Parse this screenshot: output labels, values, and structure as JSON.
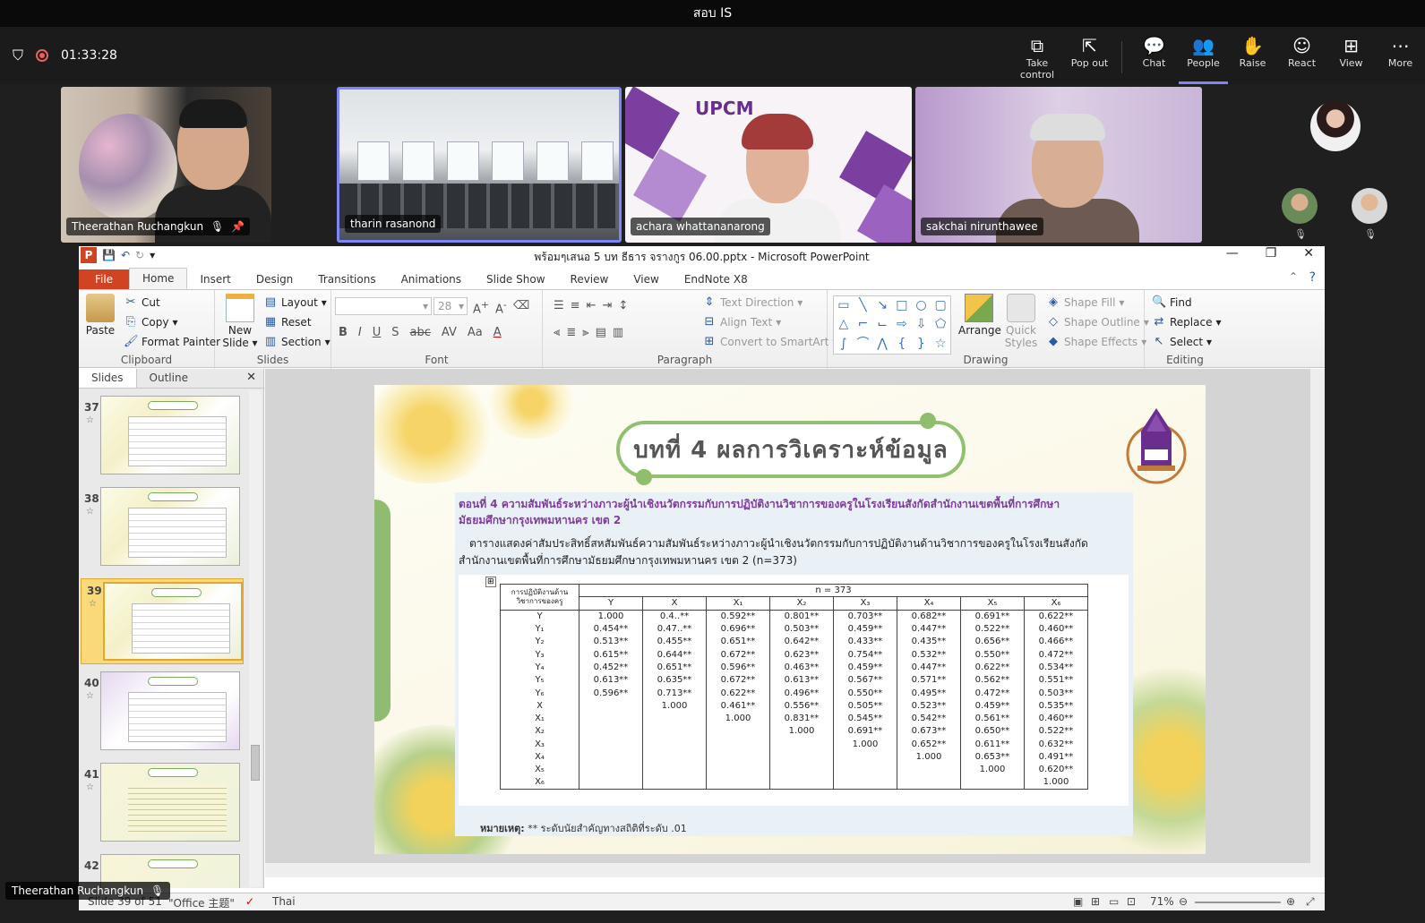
{
  "meeting": {
    "title": "สอบ IS",
    "recording_time": "01:33:28",
    "actions": [
      {
        "label": "Take control",
        "icon": "take-control-icon"
      },
      {
        "label": "Pop out",
        "icon": "pop-out-icon"
      },
      {
        "label": "Chat",
        "icon": "chat-icon"
      },
      {
        "label": "People",
        "icon": "people-icon"
      },
      {
        "label": "Raise",
        "icon": "raise-hand-icon"
      },
      {
        "label": "React",
        "icon": "react-icon"
      },
      {
        "label": "View",
        "icon": "view-icon"
      },
      {
        "label": "More",
        "icon": "more-icon"
      }
    ],
    "participants": [
      {
        "name": "Theerathan Ruchangkun"
      },
      {
        "name": "tharin rasanond"
      },
      {
        "name": "achara whattananarong"
      },
      {
        "name": "sakchai nirunthawee"
      }
    ],
    "presenter_name": "Theerathan Ruchangkun"
  },
  "ppt": {
    "window_title": "พร้อมๆเสนอ 5 บท ธีธาร จรางกูร 06.00.pptx  -  Microsoft PowerPoint",
    "tabs": [
      "File",
      "Home",
      "Insert",
      "Design",
      "Transitions",
      "Animations",
      "Slide Show",
      "Review",
      "View",
      "EndNote X8"
    ],
    "ribbon": {
      "clipboard": {
        "label": "Clipboard",
        "paste": "Paste",
        "cut": "Cut",
        "copy": "Copy",
        "format_painter": "Format Painter"
      },
      "slides": {
        "label": "Slides",
        "new_slide": "New Slide",
        "layout": "Layout",
        "reset": "Reset",
        "section": "Section"
      },
      "font": {
        "label": "Font",
        "size": "28"
      },
      "paragraph": {
        "label": "Paragraph",
        "text_direction": "Text Direction",
        "align_text": "Align Text",
        "convert_smartart": "Convert to SmartArt"
      },
      "drawing": {
        "label": "Drawing",
        "arrange": "Arrange",
        "quick_styles": "Quick Styles",
        "shape_fill": "Shape Fill",
        "shape_outline": "Shape Outline",
        "shape_effects": "Shape Effects"
      },
      "editing": {
        "label": "Editing",
        "find": "Find",
        "replace": "Replace",
        "select": "Select"
      }
    },
    "panel_tabs": [
      "Slides",
      "Outline"
    ],
    "thumbnails": [
      {
        "num": "37"
      },
      {
        "num": "38"
      },
      {
        "num": "39"
      },
      {
        "num": "40"
      },
      {
        "num": "41"
      },
      {
        "num": "42"
      }
    ],
    "slide": {
      "heading": "บทที่ 4  ผลการวิเคราะห์ข้อมูล",
      "subtitle": "ตอนที่ 4 ความสัมพันธ์ระหว่างภาวะผู้นำเชิงนวัตกรรมกับการปฏิบัติงานวิชาการของครูในโรงเรียนสังกัดสำนักงานเขตพื้นที่การศึกษามัธยมศึกษากรุงเทพมหานคร  เขต 2",
      "description": "ตารางแสดงค่าสัมประสิทธิ์สหสัมพันธ์ความสัมพันธ์ระหว่างภาวะผู้นำเชิงนวัตกรรมกับการปฏิบัติงานด้านวิชาการของครูในโรงเรียนสังกัดสำนักงานเขตพื้นที่การศึกษามัธยมศึกษากรุงเทพมหานคร เขต 2 (n=373)",
      "table": {
        "corner_label": "การปฏิบัติงานด้านวิชาการของครู",
        "n_label": "n = 373",
        "columns": [
          "Y",
          "X",
          "X₁",
          "X₂",
          "X₃",
          "X₄",
          "X₅",
          "X₆"
        ],
        "rows": [
          {
            "label": "Y",
            "cells": [
              "1.000",
              "0.4..**",
              "0.592**",
              "0.801**",
              "0.703**",
              "0.682**",
              "0.691**",
              "0.622**"
            ]
          },
          {
            "label": "Y₁",
            "cells": [
              "0.454**",
              "0.47..**",
              "0.696**",
              "0.503**",
              "0.459**",
              "0.447**",
              "0.522**",
              "0.460**"
            ]
          },
          {
            "label": "Y₂",
            "cells": [
              "0.513**",
              "0.455**",
              "0.651**",
              "0.642**",
              "0.433**",
              "0.435**",
              "0.656**",
              "0.466**"
            ]
          },
          {
            "label": "Y₃",
            "cells": [
              "0.615**",
              "0.644**",
              "0.672**",
              "0.623**",
              "0.754**",
              "0.532**",
              "0.550**",
              "0.472**"
            ]
          },
          {
            "label": "Y₄",
            "cells": [
              "0.452**",
              "0.651**",
              "0.596**",
              "0.463**",
              "0.459**",
              "0.447**",
              "0.622**",
              "0.534**"
            ]
          },
          {
            "label": "Y₅",
            "cells": [
              "0.613**",
              "0.635**",
              "0.672**",
              "0.613**",
              "0.567**",
              "0.571**",
              "0.562**",
              "0.551**"
            ]
          },
          {
            "label": "Y₆",
            "cells": [
              "0.596**",
              "0.713**",
              "0.622**",
              "0.496**",
              "0.550**",
              "0.495**",
              "0.472**",
              "0.503**"
            ]
          },
          {
            "label": "X",
            "cells": [
              "",
              "1.000",
              "0.461**",
              "0.556**",
              "0.505**",
              "0.523**",
              "0.459**",
              "0.535**"
            ]
          },
          {
            "label": "X₁",
            "cells": [
              "",
              "",
              "1.000",
              "0.831**",
              "0.545**",
              "0.542**",
              "0.561**",
              "0.460**"
            ]
          },
          {
            "label": "X₂",
            "cells": [
              "",
              "",
              "",
              "1.000",
              "0.691**",
              "0.673**",
              "0.650**",
              "0.522**"
            ]
          },
          {
            "label": "X₃",
            "cells": [
              "",
              "",
              "",
              "",
              "1.000",
              "0.652**",
              "0.611**",
              "0.632**"
            ]
          },
          {
            "label": "X₄",
            "cells": [
              "",
              "",
              "",
              "",
              "",
              "1.000",
              "0.653**",
              "0.491**"
            ]
          },
          {
            "label": "X₅",
            "cells": [
              "",
              "",
              "",
              "",
              "",
              "",
              "1.000",
              "0.620**"
            ]
          },
          {
            "label": "X₆",
            "cells": [
              "",
              "",
              "",
              "",
              "",
              "",
              "",
              "1.000"
            ]
          }
        ]
      },
      "note_label": "หมายเหตุ:",
      "note_text": "** ระดับนัยสำคัญทางสถิติที่ระดับ  .01"
    },
    "status": {
      "slide_info": "Slide 39 of 51",
      "theme": "\"Office 主题\"",
      "language": "Thai",
      "zoom": "71%"
    }
  }
}
